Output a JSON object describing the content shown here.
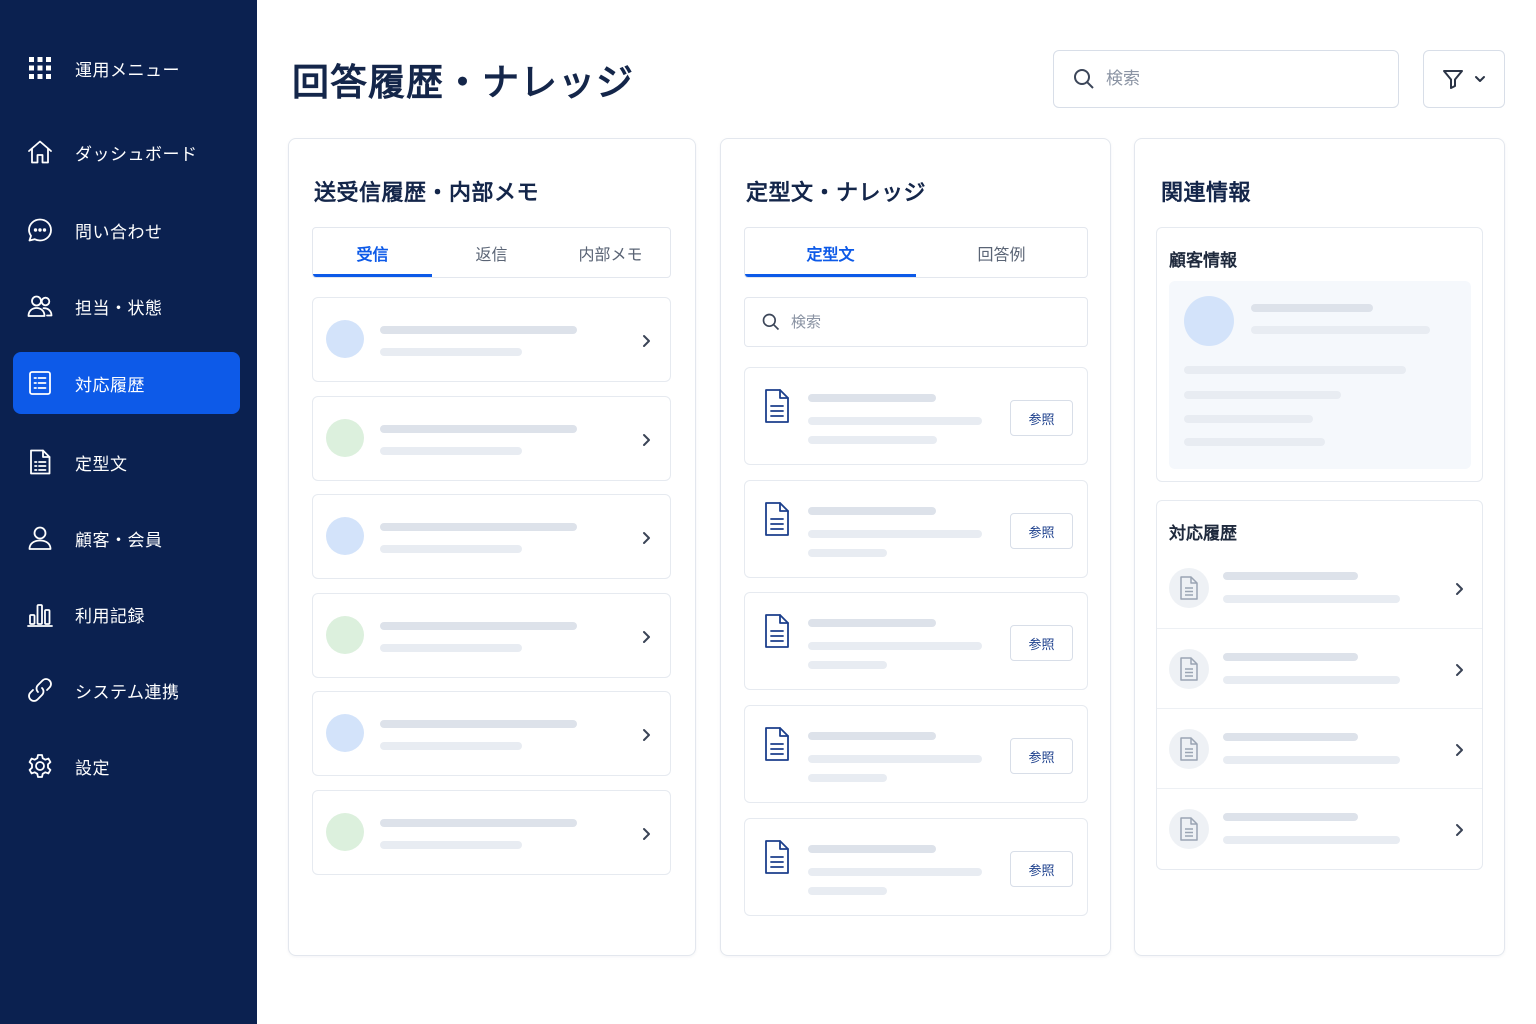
{
  "sidebar": {
    "menu_title": "運用メニュー",
    "items": [
      {
        "label": "ダッシュボード",
        "icon": "home-icon"
      },
      {
        "label": "問い合わせ",
        "icon": "chat-icon"
      },
      {
        "label": "担当・状態",
        "icon": "users-icon"
      },
      {
        "label": "対応履歴",
        "icon": "list-icon",
        "active": true
      },
      {
        "label": "定型文",
        "icon": "document-icon"
      },
      {
        "label": "顧客・会員",
        "icon": "user-icon"
      },
      {
        "label": "利用記録",
        "icon": "bar-chart-icon"
      },
      {
        "label": "システム連携",
        "icon": "link-icon"
      },
      {
        "label": "設定",
        "icon": "gear-icon"
      }
    ]
  },
  "header": {
    "title": "回答履歴・ナレッジ",
    "search_placeholder": "検索"
  },
  "messages_panel": {
    "title": "送受信履歴・内部メモ",
    "tabs": [
      "受信",
      "返信",
      "内部メモ"
    ],
    "active_tab": "受信"
  },
  "templates_panel": {
    "title": "定型文・ナレッジ",
    "tabs": [
      "定型文",
      "回答例"
    ],
    "active_tab": "定型文",
    "search_placeholder": "検索",
    "ref_label": "参照"
  },
  "related_panel": {
    "title": "関連情報",
    "customer_title": "顧客情報",
    "history_title": "対応履歴"
  },
  "colors": {
    "sidebar_bg": "#0b2150",
    "accent": "#0d5ae8",
    "avatar_blue": "#d3e3fa",
    "avatar_green": "#dcf0dd"
  }
}
